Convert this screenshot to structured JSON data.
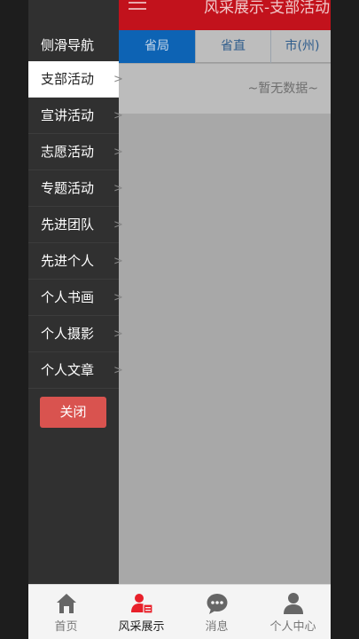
{
  "header": {
    "title": "风采展示-支部活动",
    "menu_icon": "hamburger-icon"
  },
  "tabs": [
    {
      "label": "省局",
      "active": true
    },
    {
      "label": "省直",
      "active": false
    },
    {
      "label": "市(州)",
      "active": false
    }
  ],
  "main": {
    "empty_text": "~暂无数据~"
  },
  "drawer": {
    "title": "侧滑导航",
    "items": [
      {
        "label": "支部活动",
        "active": true
      },
      {
        "label": "宣讲活动",
        "active": false
      },
      {
        "label": "志愿活动",
        "active": false
      },
      {
        "label": "专题活动",
        "active": false
      },
      {
        "label": "先进团队",
        "active": false
      },
      {
        "label": "先进个人",
        "active": false
      },
      {
        "label": "个人书画",
        "active": false
      },
      {
        "label": "个人摄影",
        "active": false
      },
      {
        "label": "个人文章",
        "active": false
      }
    ],
    "arrow_glyph": ">",
    "close_label": "关闭"
  },
  "bottom_nav": [
    {
      "label": "首页",
      "icon": "home-icon",
      "active": false
    },
    {
      "label": "风采展示",
      "icon": "profile-card-icon",
      "active": true
    },
    {
      "label": "消息",
      "icon": "message-icon",
      "active": false
    },
    {
      "label": "个人中心",
      "icon": "person-icon",
      "active": false
    }
  ],
  "colors": {
    "header_red": "#c2121c",
    "tab_active_blue": "#0d63b4",
    "close_button": "#d9534f",
    "drawer_bg": "#303030",
    "nav_active_red": "#e8202a"
  }
}
